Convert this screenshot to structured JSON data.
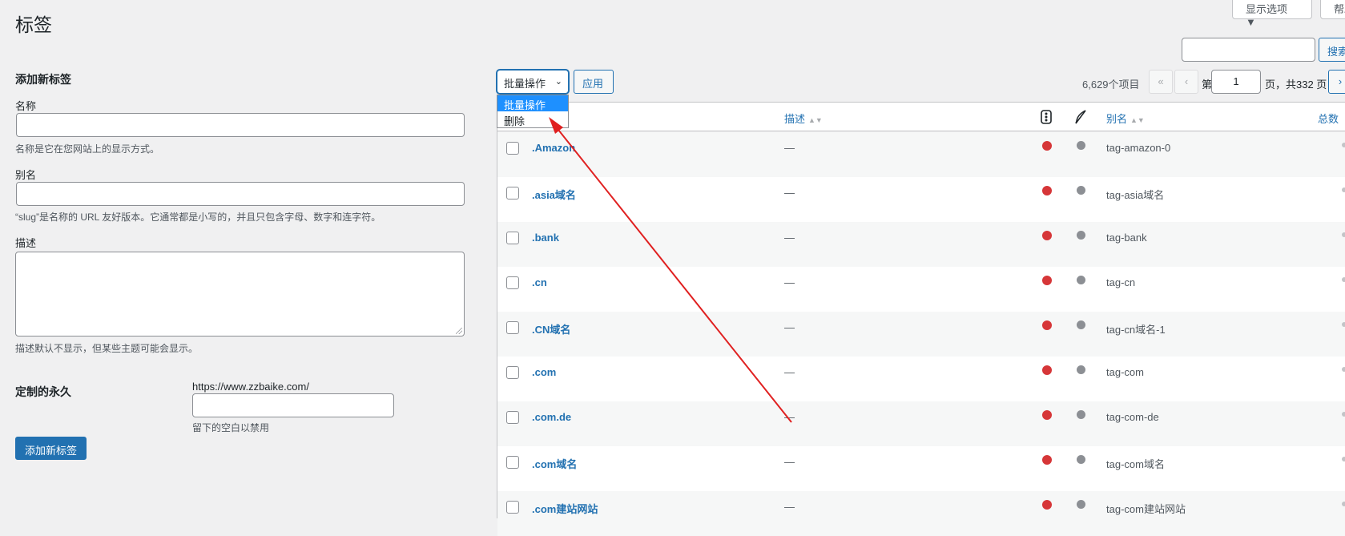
{
  "page": {
    "title": "标签"
  },
  "top_buttons": {
    "screen_options": "显示选项 ▼",
    "help": "帮助"
  },
  "search": {
    "button": "搜索"
  },
  "form": {
    "heading": "添加新标签",
    "name_label": "名称",
    "name_hint": "名称是它在您网站上的显示方式。",
    "slug_label": "别名",
    "slug_hint": "“slug”是名称的 URL 友好版本。它通常都是小写的，并且只包含字母、数字和连字符。",
    "desc_label": "描述",
    "desc_hint": "描述默认不显示，但某些主题可能会显示。",
    "permalink_label": "定制的永久",
    "permalink_prefix": "https://www.zzbaike.com/",
    "permalink_hint": "留下的空白以禁用",
    "submit": "添加新标签"
  },
  "bulk": {
    "selected": "批量操作",
    "apply": "应用",
    "options": [
      "批量操作",
      "删除"
    ]
  },
  "pagination": {
    "count": "6,629个项目",
    "first": "«",
    "prev": "‹",
    "next": "›",
    "page_prefix": "第",
    "current_page": "1",
    "page_suffix": "页，共332 页"
  },
  "table": {
    "headers": {
      "desc": "描述",
      "slug": "别名",
      "count": "总数"
    },
    "rows": [
      {
        "name": ".Amazon",
        "desc": "—",
        "slug": "tag-amazon-0"
      },
      {
        "name": ".asia域名",
        "desc": "—",
        "slug": "tag-asia域名"
      },
      {
        "name": ".bank",
        "desc": "—",
        "slug": "tag-bank"
      },
      {
        "name": ".cn",
        "desc": "—",
        "slug": "tag-cn"
      },
      {
        "name": ".CN域名",
        "desc": "—",
        "slug": "tag-cn域名-1"
      },
      {
        "name": ".com",
        "desc": "—",
        "slug": "tag-com"
      },
      {
        "name": ".com.de",
        "desc": "—",
        "slug": "tag-com-de"
      },
      {
        "name": ".com域名",
        "desc": "—",
        "slug": "tag-com域名"
      },
      {
        "name": ".com建站网站",
        "desc": "—",
        "slug": "tag-com建站网站"
      }
    ]
  },
  "colors": {
    "accent": "#2271b1",
    "red_dot": "#d63638",
    "grey_dot": "#8c8f94",
    "arrow": "#e02020"
  }
}
